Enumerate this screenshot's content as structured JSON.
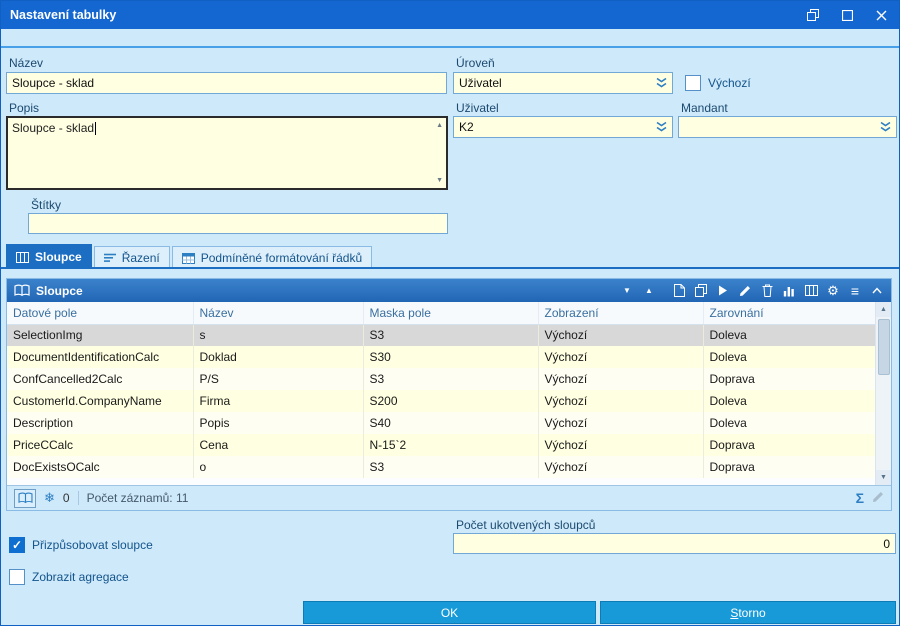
{
  "window": {
    "title": "Nastavení tabulky"
  },
  "form": {
    "nazev": {
      "label": "Název",
      "value": "Sloupce - sklad"
    },
    "uroven": {
      "label": "Úroveň",
      "value": "Uživatel"
    },
    "vychozi": {
      "label": "Výchozí",
      "checked": false
    },
    "popis": {
      "label": "Popis",
      "value": "Sloupce - sklad"
    },
    "uzivatel": {
      "label": "Uživatel",
      "value": "K2"
    },
    "mandant": {
      "label": "Mandant",
      "value": ""
    },
    "stitky": {
      "label": "Štítky",
      "value": ""
    }
  },
  "tabs": [
    {
      "label": "Sloupce",
      "active": true
    },
    {
      "label": "Řazení",
      "active": false
    },
    {
      "label": "Podmíněné formátování řádků",
      "active": false
    }
  ],
  "panel": {
    "title": "Sloupce",
    "table": {
      "columns": [
        "Datové pole",
        "Název",
        "Maska pole",
        "Zobrazení",
        "Zarovnání"
      ],
      "rows": [
        [
          "SelectionImg",
          "s",
          "S3",
          "Výchozí",
          "Doleva"
        ],
        [
          "DocumentIdentificationCalc",
          "Doklad",
          "S30",
          "Výchozí",
          "Doleva"
        ],
        [
          "ConfCancelled2Calc",
          "P/S",
          "S3",
          "Výchozí",
          "Doprava"
        ],
        [
          "CustomerId.CompanyName",
          "Firma",
          "S200",
          "Výchozí",
          "Doleva"
        ],
        [
          "Description",
          "Popis",
          "S40",
          "Výchozí",
          "Doleva"
        ],
        [
          "PriceCCalc",
          "Cena",
          "N-15`2",
          "Výchozí",
          "Doprava"
        ],
        [
          "DocExistsOCalc",
          "o",
          "S3",
          "Výchozí",
          "Doprava"
        ]
      ],
      "selected_row": 0
    },
    "status": {
      "frozen_count": "0",
      "records_label": "Počet záznamů: 11"
    }
  },
  "footer": {
    "fit_columns": {
      "label": "Přizpůsobovat sloupce",
      "checked": true
    },
    "show_aggregations": {
      "label": "Zobrazit agregace",
      "checked": false
    },
    "anchored_columns": {
      "label": "Počet ukotvených sloupců",
      "value": "0"
    },
    "ok_label": "OK",
    "storno_label": "Storno"
  },
  "colors": {
    "titlebar": "#1467d1",
    "dialog_bg": "#cee9fa",
    "field_bg": "#ffffe1",
    "accent_blue": "#1b6ec2",
    "panel_header": "#2b72bf",
    "button_blue": "#199ad8",
    "selected_row": "#d8d8d8"
  }
}
